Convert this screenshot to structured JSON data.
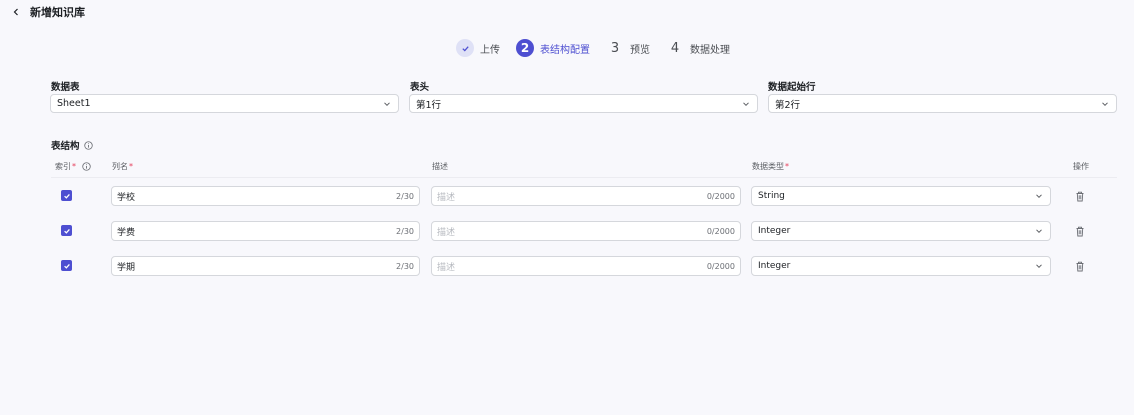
{
  "header": {
    "title": "新增知识库",
    "back_icon": "chevron-left-icon"
  },
  "steps": [
    {
      "number": "✓",
      "label": "上传",
      "state": "done"
    },
    {
      "number": "2",
      "label": "表结构配置",
      "state": "active"
    },
    {
      "number": "3",
      "label": "预览",
      "state": "todo"
    },
    {
      "number": "4",
      "label": "数据处理",
      "state": "todo"
    }
  ],
  "config": {
    "sheet": {
      "label": "数据表",
      "value": "Sheet1"
    },
    "header_row": {
      "label": "表头",
      "value": "第1行"
    },
    "data_start_row": {
      "label": "数据起始行",
      "value": "第2行"
    }
  },
  "table_structure": {
    "title": "表结构",
    "columns": {
      "index": "索引",
      "name": "列名",
      "description": "描述",
      "data_type": "数据类型",
      "actions": "操作"
    },
    "rows": [
      {
        "checked": true,
        "name": "学校",
        "name_count": "2/30",
        "desc_placeholder": "描述",
        "desc_count": "0/2000",
        "type": "String"
      },
      {
        "checked": true,
        "name": "学费",
        "name_count": "2/30",
        "desc_placeholder": "描述",
        "desc_count": "0/2000",
        "type": "Integer"
      },
      {
        "checked": true,
        "name": "学期",
        "name_count": "2/30",
        "desc_placeholder": "描述",
        "desc_count": "0/2000",
        "type": "Integer"
      }
    ]
  },
  "colors": {
    "accent": "#4e4fd1",
    "required": "#e53e5a",
    "background": "#f8f8fc"
  }
}
